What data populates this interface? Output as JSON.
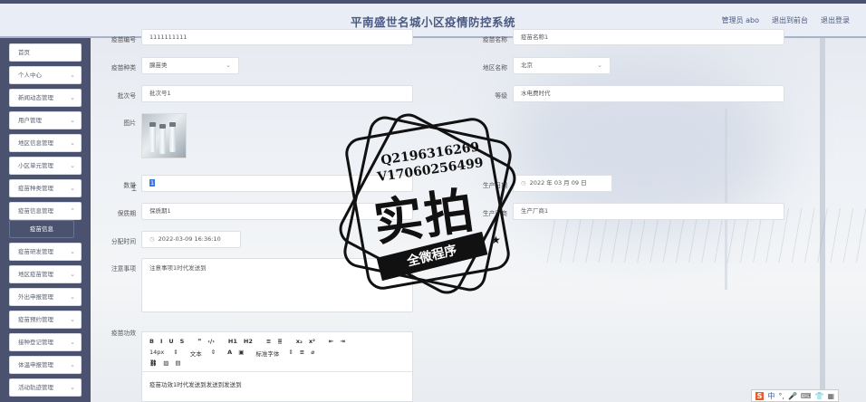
{
  "header": {
    "title": "平南盛世名城小区疫情防控系统",
    "user": "管理员 abo",
    "frontend_link": "退出到前台",
    "logout": "退出登录"
  },
  "sidebar": {
    "items": [
      {
        "label": "首页",
        "has_chevron": false
      },
      {
        "label": "个人中心",
        "has_chevron": true
      },
      {
        "label": "新闻动态管理",
        "has_chevron": true
      },
      {
        "label": "用户管理",
        "has_chevron": true
      },
      {
        "label": "地区信息管理",
        "has_chevron": true
      },
      {
        "label": "小区单元管理",
        "has_chevron": true
      },
      {
        "label": "疫苗种类管理",
        "has_chevron": true
      },
      {
        "label": "疫苗信息管理",
        "has_chevron": true
      },
      {
        "label": "疫苗研发管理",
        "has_chevron": true
      },
      {
        "label": "地区疫苗管理",
        "has_chevron": true
      },
      {
        "label": "外出申报管理",
        "has_chevron": true
      },
      {
        "label": "疫苗预约管理",
        "has_chevron": true
      },
      {
        "label": "接种登记管理",
        "has_chevron": true
      },
      {
        "label": "体温申报管理",
        "has_chevron": true
      },
      {
        "label": "活动轨迹管理",
        "has_chevron": true
      }
    ],
    "sub_item": "疫苗信息"
  },
  "form": {
    "vaccine_no_label": "疫苗编号",
    "vaccine_no_value": "1111111111",
    "vaccine_name_label": "疫苗名称",
    "vaccine_name_value": "疫苗名称1",
    "vaccine_type_label": "疫苗种类",
    "vaccine_type_value": "腺苗类",
    "region_label": "地区名称",
    "region_value": "北京",
    "batch_label": "批次号",
    "batch_value": "批次号1",
    "grade_label": "等级",
    "grade_value": "水电费时代",
    "image_label": "图片",
    "quantity_label": "数量",
    "quantity_value": "1",
    "prod_date_label": "生产日期",
    "prod_date_value": "2022 年 03 月 09 日",
    "shelf_label": "保质期",
    "shelf_value": "保质期1",
    "maker_label": "生产厂商",
    "maker_value": "生产厂商1",
    "alloc_time_label": "分配时间",
    "alloc_time_value": "2022-03-09 16:36:10",
    "notes_label": "注意事项",
    "notes_value": "注意事项1时代发送到",
    "efficacy_label": "疫苗功效",
    "efficacy_value": "疫苗功效1时代发送到发送到发送到"
  },
  "editor": {
    "row1": [
      "B",
      "I",
      "U",
      "S",
      "❞",
      "‹/›",
      "H1",
      "H2",
      "≡",
      "≣",
      "x₂",
      "x²",
      "⇤",
      "⇥"
    ],
    "font_size": "14px",
    "text_style": "文本",
    "font_family": "标准字体"
  },
  "watermark": {
    "line1": "Q2196316269",
    "line2": "V17060256499",
    "big": "实拍",
    "ribbon": "全微程序"
  },
  "ime": {
    "label": "中"
  }
}
